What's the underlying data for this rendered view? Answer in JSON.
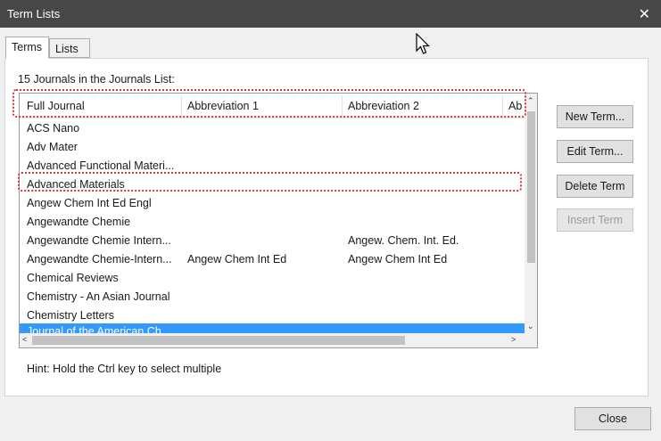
{
  "window": {
    "title": "Term Lists"
  },
  "tabs": [
    {
      "label": "Terms",
      "active": true
    },
    {
      "label": "Lists",
      "active": false
    }
  ],
  "count_label": "15 Journals in the Journals List:",
  "columns": [
    "Full Journal",
    "Abbreviation 1",
    "Abbreviation 2",
    "Ab"
  ],
  "rows": [
    {
      "full": "ACS Nano",
      "abbr1": "",
      "abbr2": ""
    },
    {
      "full": "Adv Mater",
      "abbr1": "",
      "abbr2": ""
    },
    {
      "full": "Advanced Functional Materi...",
      "abbr1": "",
      "abbr2": ""
    },
    {
      "full": "Advanced Materials",
      "abbr1": "",
      "abbr2": ""
    },
    {
      "full": "Angew Chem Int Ed Engl",
      "abbr1": "",
      "abbr2": ""
    },
    {
      "full": "Angewandte Chemie",
      "abbr1": "",
      "abbr2": ""
    },
    {
      "full": "Angewandte Chemie Intern...",
      "abbr1": "",
      "abbr2": "Angew. Chem. Int. Ed."
    },
    {
      "full": "Angewandte Chemie-Intern...",
      "abbr1": "Angew Chem Int Ed",
      "abbr2": "Angew Chem Int Ed"
    },
    {
      "full": "Chemical Reviews",
      "abbr1": "",
      "abbr2": ""
    },
    {
      "full": "Chemistry - An Asian Journal",
      "abbr1": "",
      "abbr2": ""
    },
    {
      "full": "Chemistry Letters",
      "abbr1": "",
      "abbr2": ""
    },
    {
      "full": "Journal of the American Ch...",
      "abbr1": "",
      "abbr2": "",
      "selected": true
    }
  ],
  "buttons": {
    "new_term": "New Term...",
    "edit_term": "Edit Term...",
    "delete_term": "Delete Term",
    "insert_term": "Insert Term",
    "close": "Close"
  },
  "hint": "Hint: Hold the Ctrl key to select multiple",
  "colors": {
    "titlebar": "#474747",
    "selection": "#3399ff",
    "highlight": "#d0393b"
  }
}
